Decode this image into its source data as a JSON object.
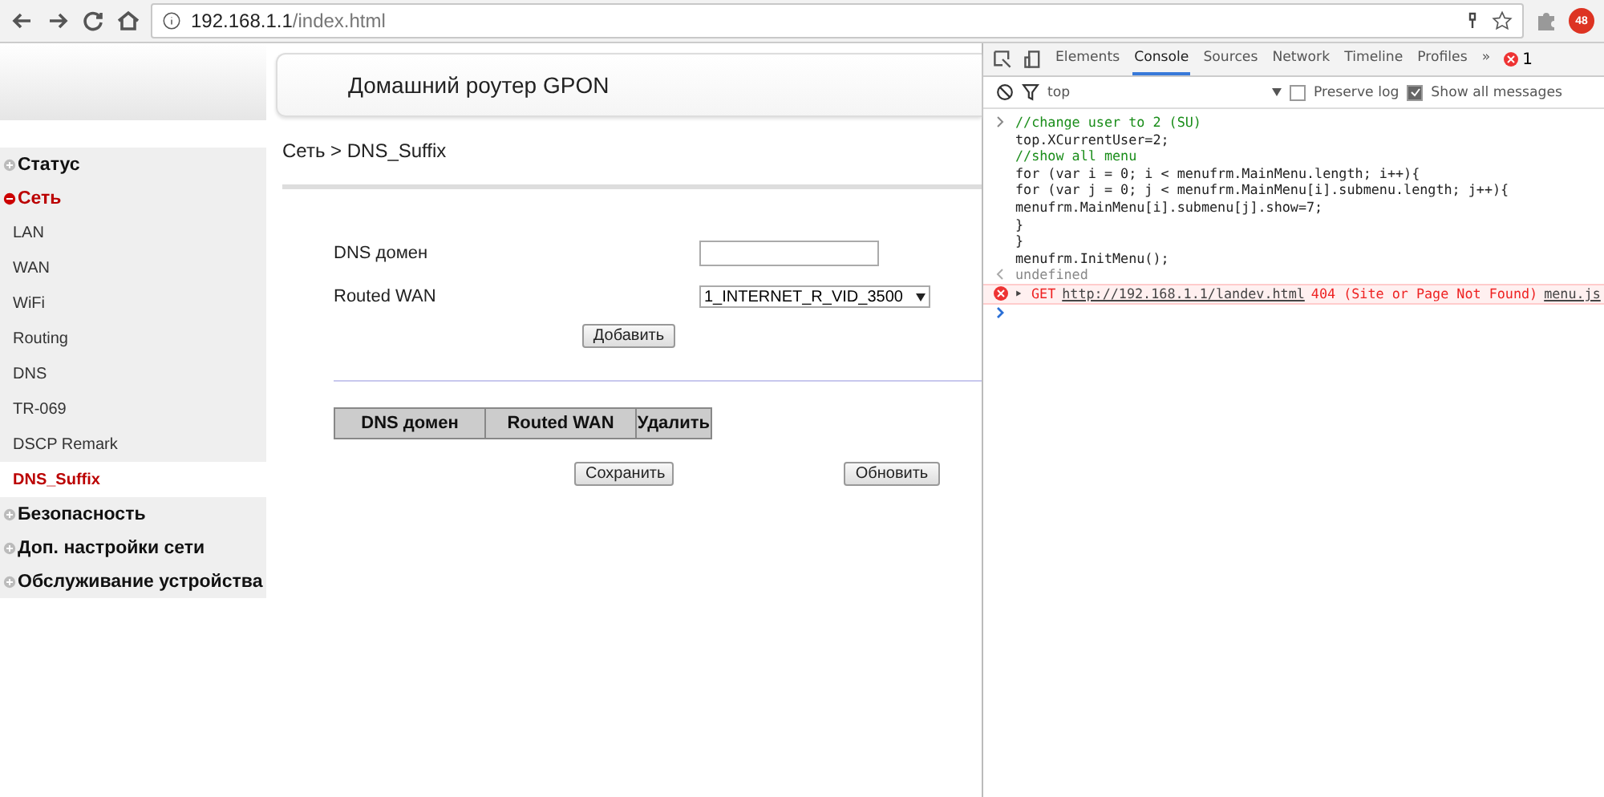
{
  "browser": {
    "url_host": "192.168.1.1",
    "url_path": "/index.html",
    "extension_badge": "48"
  },
  "header": {
    "title": "Домашний роутер GPON"
  },
  "sidebar": {
    "items": [
      {
        "label": "Статус",
        "expanded": false
      },
      {
        "label": "Сеть",
        "expanded": true,
        "children": [
          {
            "label": "LAN",
            "selected": false
          },
          {
            "label": "WAN",
            "selected": false
          },
          {
            "label": "WiFi",
            "selected": false
          },
          {
            "label": "Routing",
            "selected": false
          },
          {
            "label": "DNS",
            "selected": false
          },
          {
            "label": "TR-069",
            "selected": false
          },
          {
            "label": "DSCP Remark",
            "selected": false
          },
          {
            "label": "DNS_Suffix",
            "selected": true
          }
        ]
      },
      {
        "label": "Безопасность",
        "expanded": false
      },
      {
        "label": "Доп. настройки сети",
        "expanded": false
      },
      {
        "label": "Обслуживание устройства",
        "expanded": false
      }
    ]
  },
  "content": {
    "breadcrumb": "Сеть > DNS_Suffix",
    "form": [
      {
        "kind": "text",
        "label": "DNS домен"
      },
      {
        "kind": "select",
        "label": "Routed WAN",
        "value": "1_INTERNET_R_VID_3500"
      }
    ],
    "add_button": "Добавить",
    "table": {
      "columns": [
        "DNS домен",
        "Routed WAN",
        "Удалить"
      ]
    },
    "save_button": "Сохранить",
    "refresh_button": "Обновить"
  },
  "devtools": {
    "tabs": [
      {
        "label": "Elements",
        "selected": false
      },
      {
        "label": "Console",
        "selected": true
      },
      {
        "label": "Sources",
        "selected": false
      },
      {
        "label": "Network",
        "selected": false
      },
      {
        "label": "Timeline",
        "selected": false
      },
      {
        "label": "Profiles",
        "selected": false
      }
    ],
    "more": "»",
    "error_count": "1",
    "context": "top",
    "preserve_log": {
      "label": "Preserve log",
      "checked": false
    },
    "show_all": {
      "label": "Show all messages",
      "checked": true
    },
    "console": [
      {
        "kind": "input",
        "lines": [
          {
            "kind": "comment",
            "text": "//change user to 2 (SU)"
          },
          {
            "kind": "code",
            "text": "top.XCurrentUser=2;"
          },
          {
            "kind": "comment",
            "text": "//show all menu"
          },
          {
            "kind": "code",
            "text": "for (var i = 0; i < menufrm.MainMenu.length; i++){"
          },
          {
            "kind": "code",
            "text": "for (var j = 0; j < menufrm.MainMenu[i].submenu.length; j++){"
          },
          {
            "kind": "code",
            "text": "menufrm.MainMenu[i].submenu[j].show=7;"
          },
          {
            "kind": "code",
            "text": "}"
          },
          {
            "kind": "code",
            "text": "}"
          },
          {
            "kind": "code",
            "text": "menufrm.InitMenu();"
          }
        ]
      },
      {
        "kind": "result",
        "text": "undefined"
      },
      {
        "kind": "error",
        "method": "GET",
        "url": "http://192.168.1.1/landev.html",
        "message": "404 (Site or Page Not Found)",
        "source": "menu.js"
      },
      {
        "kind": "prompt"
      }
    ]
  }
}
